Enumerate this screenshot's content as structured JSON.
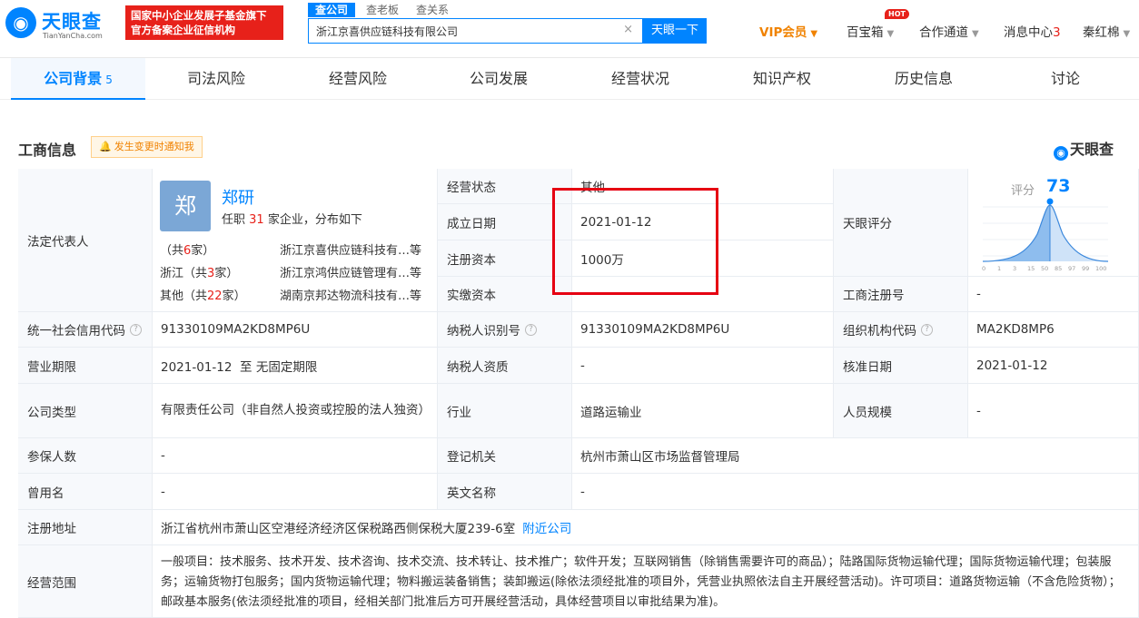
{
  "header": {
    "logo_cn": "天眼查",
    "logo_en": "TianYanCha.com",
    "fund_line1": "国家中小企业发展子基金旗下",
    "fund_line2": "官方备案企业征信机构",
    "search_tabs": [
      "查公司",
      "查老板",
      "查关系"
    ],
    "search_value": "浙江京喜供应链科技有限公司",
    "search_clear": "×",
    "search_button": "天眼一下",
    "nav": {
      "vip": "VIP会员",
      "baibaoxiang": "百宝箱",
      "hot": "HOT",
      "cooperation": "合作通道",
      "message": "消息中心",
      "message_count": "3",
      "user": "秦红棉"
    }
  },
  "tabs": [
    {
      "label": "公司背景",
      "count": "5"
    },
    {
      "label": "司法风险"
    },
    {
      "label": "经营风险"
    },
    {
      "label": "公司发展"
    },
    {
      "label": "经营状况"
    },
    {
      "label": "知识产权"
    },
    {
      "label": "历史信息"
    },
    {
      "label": "讨论"
    }
  ],
  "section": {
    "title": "工商信息",
    "notify": "发生变更时通知我",
    "brand": "天眼查"
  },
  "legal_rep": {
    "label": "法定代表人",
    "avatar_char": "郑",
    "name": "郑研",
    "sub_prefix": "任职",
    "sub_count": "31",
    "sub_suffix": "家企业，分布如下",
    "rows": [
      {
        "region": "",
        "prefix": "（共",
        "count": "6",
        "suffix": "家）",
        "company": "浙江京喜供应链科技有…等"
      },
      {
        "region": "浙江",
        "prefix": "（共",
        "count": "3",
        "suffix": "家）",
        "company": "浙江京鸿供应链管理有…等"
      },
      {
        "region": "其他",
        "prefix": "（共",
        "count": "22",
        "suffix": "家）",
        "company": "湖南京邦达物流科技有…等"
      }
    ]
  },
  "fields": {
    "status_label": "经营状态",
    "status_value": "其他",
    "found_label": "成立日期",
    "found_value": "2021-01-12",
    "capital_label": "注册资本",
    "capital_value": "1000万",
    "paid_label": "实缴资本",
    "paid_value": "",
    "score_label": "天眼评分",
    "score_word": "评分",
    "score_value": "73",
    "reg_no_label": "工商注册号",
    "reg_no_value": "-",
    "credit_label": "统一社会信用代码",
    "credit_value": "91330109MA2KD8MP6U",
    "taxid_label": "纳税人识别号",
    "taxid_value": "91330109MA2KD8MP6U",
    "org_label": "组织机构代码",
    "org_value": "MA2KD8MP6",
    "term_label": "营业期限",
    "term_value": "2021-01-12  至 无固定期限",
    "taxq_label": "纳税人资质",
    "taxq_value": "-",
    "approve_label": "核准日期",
    "approve_value": "2021-01-12",
    "type_label": "公司类型",
    "type_value": "有限责任公司（非自然人投资或控股的法人独资）",
    "industry_label": "行业",
    "industry_value": "道路运输业",
    "staff_label": "人员规模",
    "staff_value": "-",
    "insured_label": "参保人数",
    "insured_value": "-",
    "authority_label": "登记机关",
    "authority_value": "杭州市萧山区市场监督管理局",
    "former_label": "曾用名",
    "former_value": "-",
    "en_label": "英文名称",
    "en_value": "-",
    "addr_label": "注册地址",
    "addr_value": "浙江省杭州市萧山区空港经济经济区保税路西侧保税大厦239-6室",
    "addr_link": "附近公司",
    "scope_label": "经营范围",
    "scope_value": "一般项目：技术服务、技术开发、技术咨询、技术交流、技术转让、技术推广；软件开发；互联网销售（除销售需要许可的商品）；陆路国际货物运输代理；国际货物运输代理；包装服务；运输货物打包服务；国内货物运输代理；物料搬运装备销售；装卸搬运(除依法须经批准的项目外，凭营业执照依法自主开展经营活动)。许可项目：道路货物运输（不含危险货物）；邮政基本服务(依法须经批准的项目，经相关部门批准后方可开展经营活动，具体经营项目以审批结果为准)。"
  },
  "score_chart": {
    "ticks": [
      "0",
      "1",
      "3",
      "15",
      "50",
      "85",
      "97",
      "99",
      "100"
    ],
    "marker_color": "#0084ff"
  }
}
